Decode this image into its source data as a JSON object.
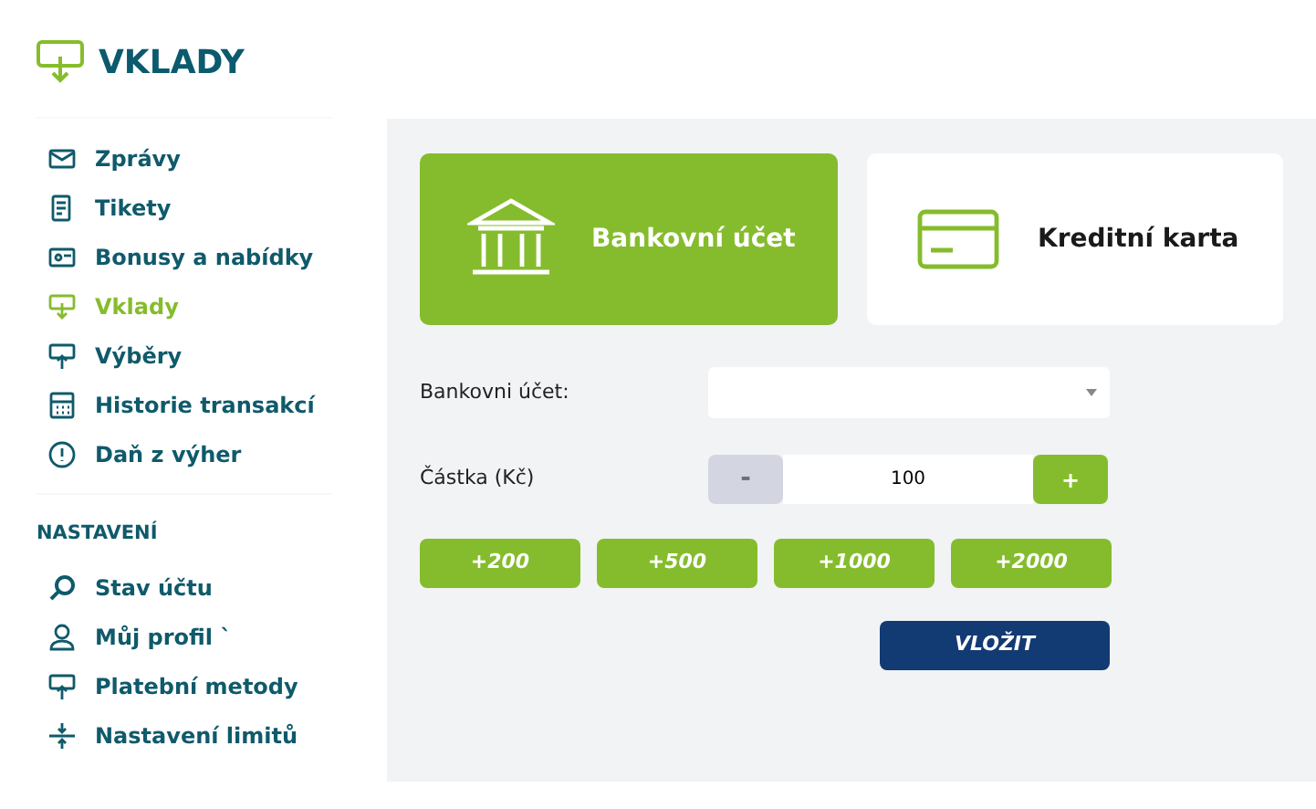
{
  "page_title": "VKLADY",
  "menu": [
    {
      "label": "Zprávy",
      "kind": "envelope",
      "selected": false
    },
    {
      "label": "Tikety",
      "kind": "receipt",
      "selected": false
    },
    {
      "label": "Bonusy a nabídky",
      "kind": "ticket",
      "selected": false
    },
    {
      "label": "Vklady",
      "kind": "deposit",
      "selected": true
    },
    {
      "label": "Výběry",
      "kind": "withdraw",
      "selected": false
    },
    {
      "label": "Historie transakcí",
      "kind": "history",
      "selected": false
    },
    {
      "label": "Daň z výher",
      "kind": "alert",
      "selected": false
    }
  ],
  "settings_heading": "NASTAVENÍ",
  "settings": [
    {
      "label": "Stav účtu",
      "kind": "search",
      "selected": false
    },
    {
      "label": "Můj profil `",
      "kind": "person",
      "selected": false
    },
    {
      "label": "Platební metody",
      "kind": "withdraw",
      "selected": false
    },
    {
      "label": "Nastavení limitů",
      "kind": "limits",
      "selected": false
    }
  ],
  "methods": [
    {
      "label": "Bankovní účet",
      "kind": "bank",
      "selected": true
    },
    {
      "label": "Kreditní karta",
      "kind": "card",
      "selected": false
    }
  ],
  "account_label": "Bankovni účet:",
  "amount_label": "Částka (Kč)",
  "amount": {
    "value": "100",
    "minus": "-",
    "plus": "+",
    "minus_disabled": true
  },
  "quick_amounts": [
    "+200",
    "+500",
    "+1000",
    "+2000"
  ],
  "submit": "VLOŽIT"
}
